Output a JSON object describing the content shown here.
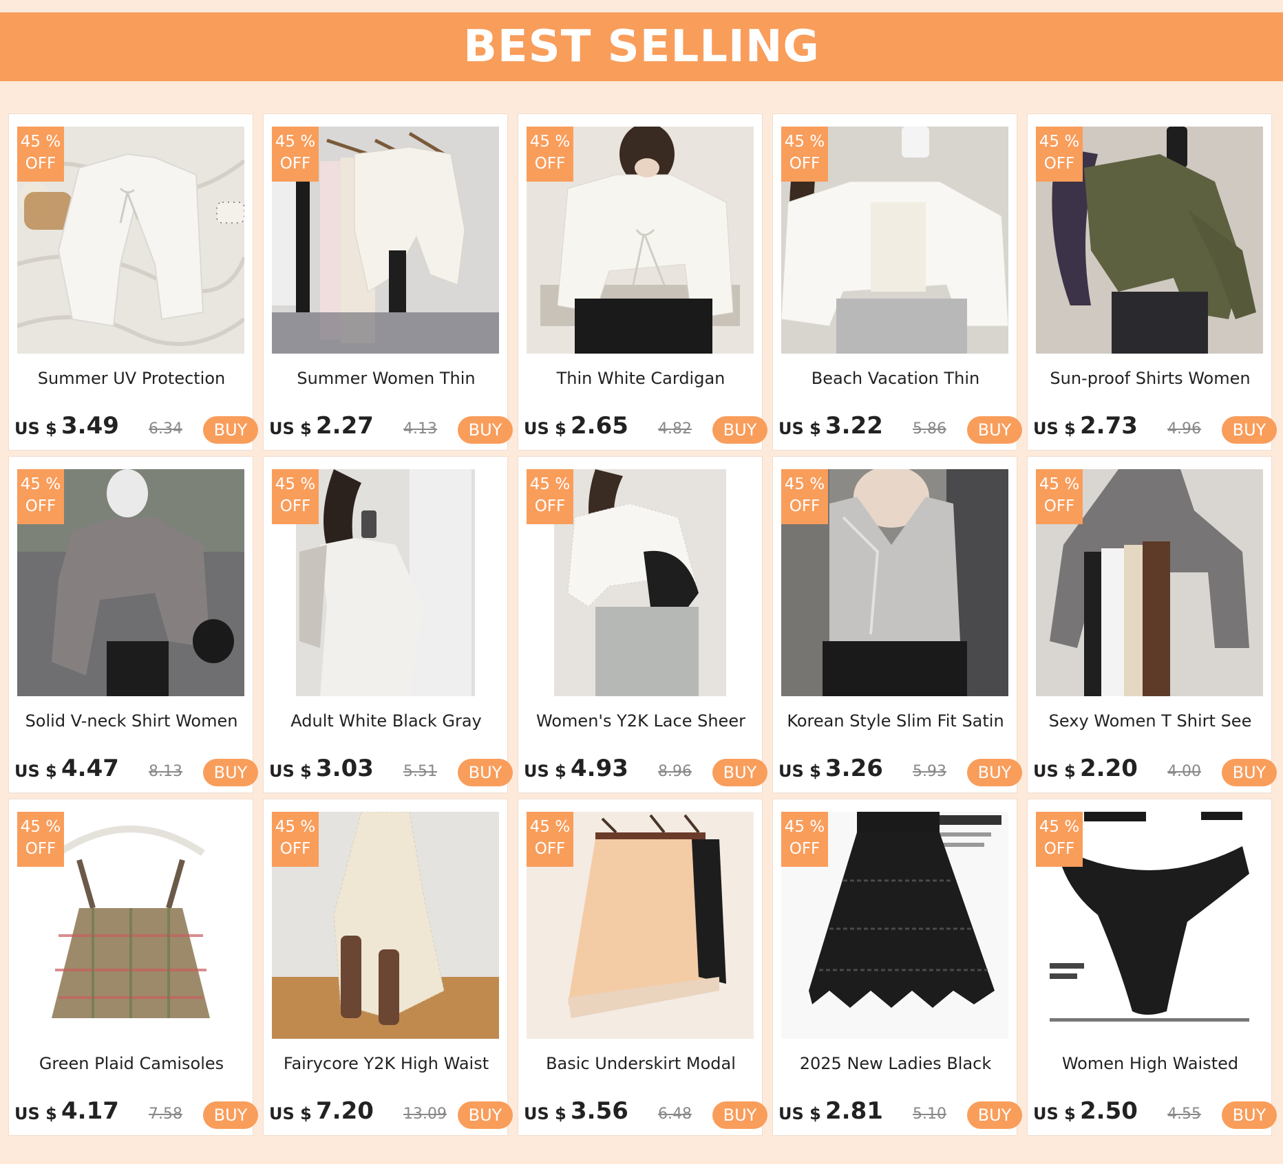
{
  "header": {
    "title": "BEST SELLING"
  },
  "products": [
    {
      "title": "Summer UV Protection",
      "currency": "US $",
      "price": "3.49",
      "old_price": "6.34",
      "badge_pct": "45 %",
      "badge_off": "OFF",
      "buy": "BUY"
    },
    {
      "title": "Summer Women Thin",
      "currency": "US $",
      "price": "2.27",
      "old_price": "4.13",
      "badge_pct": "45 %",
      "badge_off": "OFF",
      "buy": "BUY"
    },
    {
      "title": "Thin White Cardigan",
      "currency": "US $",
      "price": "2.65",
      "old_price": "4.82",
      "badge_pct": "45 %",
      "badge_off": "OFF",
      "buy": "BUY"
    },
    {
      "title": "Beach Vacation Thin",
      "currency": "US $",
      "price": "3.22",
      "old_price": "5.86",
      "badge_pct": "45 %",
      "badge_off": "OFF",
      "buy": "BUY"
    },
    {
      "title": "Sun-proof Shirts Women",
      "currency": "US $",
      "price": "2.73",
      "old_price": "4.96",
      "badge_pct": "45 %",
      "badge_off": "OFF",
      "buy": "BUY"
    },
    {
      "title": "Solid V-neck Shirt Women",
      "currency": "US $",
      "price": "4.47",
      "old_price": "8.13",
      "badge_pct": "45 %",
      "badge_off": "OFF",
      "buy": "BUY"
    },
    {
      "title": "Adult White Black Gray",
      "currency": "US $",
      "price": "3.03",
      "old_price": "5.51",
      "badge_pct": "45 %",
      "badge_off": "OFF",
      "buy": "BUY"
    },
    {
      "title": "Women's Y2K Lace Sheer",
      "currency": "US $",
      "price": "4.93",
      "old_price": "8.96",
      "badge_pct": "45 %",
      "badge_off": "OFF",
      "buy": "BUY"
    },
    {
      "title": "Korean Style Slim Fit Satin",
      "currency": "US $",
      "price": "3.26",
      "old_price": "5.93",
      "badge_pct": "45 %",
      "badge_off": "OFF",
      "buy": "BUY"
    },
    {
      "title": "Sexy Women T Shirt See",
      "currency": "US $",
      "price": "2.20",
      "old_price": "4.00",
      "badge_pct": "45 %",
      "badge_off": "OFF",
      "buy": "BUY"
    },
    {
      "title": "Green Plaid Camisoles",
      "currency": "US $",
      "price": "4.17",
      "old_price": "7.58",
      "badge_pct": "45 %",
      "badge_off": "OFF",
      "buy": "BUY"
    },
    {
      "title": "Fairycore Y2K High Waist",
      "currency": "US $",
      "price": "7.20",
      "old_price": "13.09",
      "badge_pct": "45 %",
      "badge_off": "OFF",
      "buy": "BUY"
    },
    {
      "title": "Basic Underskirt Modal",
      "currency": "US $",
      "price": "3.56",
      "old_price": "6.48",
      "badge_pct": "45 %",
      "badge_off": "OFF",
      "buy": "BUY"
    },
    {
      "title": "2025 New Ladies Black",
      "currency": "US $",
      "price": "2.81",
      "old_price": "5.10",
      "badge_pct": "45 %",
      "badge_off": "OFF",
      "buy": "BUY"
    },
    {
      "title": "Women High Waisted",
      "currency": "US $",
      "price": "2.50",
      "old_price": "4.55",
      "badge_pct": "45 %",
      "badge_off": "OFF",
      "buy": "BUY"
    }
  ],
  "colors": {
    "accent": "#f99d5b",
    "page_bg": "#fdeadb",
    "card_bg": "#ffffff",
    "text": "#222222",
    "muted": "#888888"
  }
}
